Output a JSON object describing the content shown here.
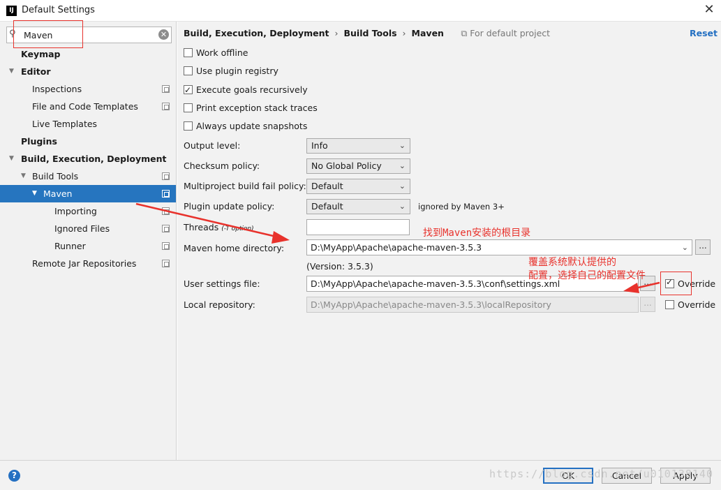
{
  "window": {
    "title": "Default Settings",
    "icon": "IJ"
  },
  "search": {
    "value": "Maven"
  },
  "sidebar": {
    "items": [
      {
        "label": "Keymap"
      },
      {
        "label": "Editor"
      },
      {
        "label": "Inspections"
      },
      {
        "label": "File and Code Templates"
      },
      {
        "label": "Live Templates"
      },
      {
        "label": "Plugins"
      },
      {
        "label": "Build, Execution, Deployment"
      },
      {
        "label": "Build Tools"
      },
      {
        "label": "Maven"
      },
      {
        "label": "Importing"
      },
      {
        "label": "Ignored Files"
      },
      {
        "label": "Runner"
      },
      {
        "label": "Remote Jar Repositories"
      }
    ]
  },
  "breadcrumb": {
    "items": [
      "Build, Execution, Deployment",
      "Build Tools",
      "Maven"
    ],
    "scope": "For default project",
    "reset": "Reset"
  },
  "options": {
    "work_offline": {
      "label": "Work offline",
      "checked": false
    },
    "use_plugin_registry": {
      "label": "Use plugin registry",
      "checked": false
    },
    "execute_goals": {
      "label": "Execute goals recursively",
      "checked": true
    },
    "print_exception": {
      "label": "Print exception stack traces",
      "checked": false
    },
    "always_update": {
      "label": "Always update snapshots",
      "checked": false
    }
  },
  "fields": {
    "output_level": {
      "label": "Output level:",
      "value": "Info"
    },
    "checksum_policy": {
      "label": "Checksum policy:",
      "value": "No Global Policy"
    },
    "multiproject": {
      "label": "Multiproject build fail policy:",
      "value": "Default"
    },
    "plugin_update": {
      "label": "Plugin update policy:",
      "value": "Default",
      "note": "ignored by Maven 3+"
    },
    "threads": {
      "label": "Threads",
      "hint": "(-T option)",
      "value": ""
    },
    "maven_home": {
      "label": "Maven home directory:",
      "value": "D:\\MyApp\\Apache\\apache-maven-3.5.3",
      "version": "(Version: 3.5.3)"
    },
    "user_settings": {
      "label": "User settings file:",
      "value": "D:\\MyApp\\Apache\\apache-maven-3.5.3\\conf\\settings.xml",
      "override_label": "Override",
      "override_checked": true
    },
    "local_repo": {
      "label": "Local repository:",
      "value": "D:\\MyApp\\Apache\\apache-maven-3.5.3\\localRepository",
      "override_label": "Override",
      "override_checked": false
    }
  },
  "buttons": {
    "browse": "...",
    "ok": "OK",
    "cancel": "Cancel",
    "apply": "Apply",
    "help": "?"
  },
  "annotations": {
    "find_home": "找到Maven安装的根目录",
    "override_line1": "覆盖系统默认提供的",
    "override_line2": "配置，选择自己的配置文件"
  },
  "watermark": "https://blog.csdn.net/u010138140",
  "colors": {
    "selection": "#2675bf",
    "link": "#2470c2",
    "annotation": "#e8322c"
  }
}
